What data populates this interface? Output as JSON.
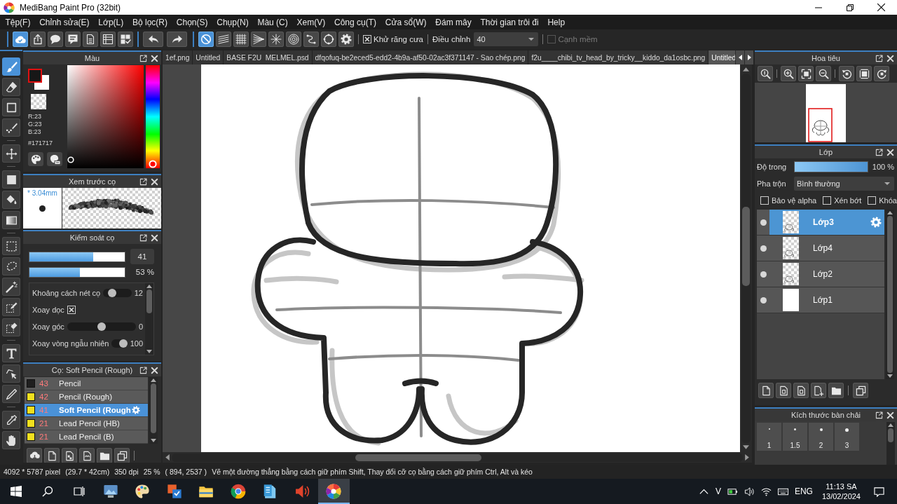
{
  "window": {
    "title": "MediBang Paint Pro (32bit)"
  },
  "menu": [
    "Tệp(F)",
    "Chỉnh sửa(E)",
    "Lớp(L)",
    "Bộ lọc(R)",
    "Chọn(S)",
    "Chụp(N)",
    "Màu (C)",
    "Xem(V)",
    "Công cụ(T)",
    "Cửa sổ(W)",
    "Đám mây",
    "Thời gian trôi đi",
    "Help"
  ],
  "toolbar": {
    "file_buttons": [
      {
        "kind": "cloud",
        "selected": true
      },
      {
        "kind": "share",
        "selected": false
      },
      {
        "kind": "speech",
        "selected": false
      },
      {
        "kind": "comment",
        "selected": false
      },
      {
        "kind": "page",
        "selected": false
      },
      {
        "kind": "table",
        "selected": false
      },
      {
        "kind": "checklist",
        "selected": false
      }
    ],
    "history_buttons": [
      {
        "kind": "undo"
      },
      {
        "kind": "redo"
      }
    ],
    "ruler_buttons": [
      {
        "kind": "off",
        "selected": true
      },
      {
        "kind": "parallel",
        "selected": false
      },
      {
        "kind": "grid",
        "selected": false
      },
      {
        "kind": "perspective",
        "selected": false
      },
      {
        "kind": "radial",
        "selected": false
      },
      {
        "kind": "concentric",
        "selected": false
      },
      {
        "kind": "curve",
        "selected": false
      },
      {
        "kind": "ellipse",
        "selected": false
      },
      {
        "kind": "gear",
        "selected": false
      }
    ],
    "antialias": {
      "label": "Khử răng cưa",
      "checked": true
    },
    "correction": {
      "label": "Điều chỉnh",
      "value": "40"
    },
    "soft_edge": {
      "label": "Cạnh mềm",
      "checked": false,
      "disabled": true
    }
  },
  "tool_groups": [
    [
      {
        "kind": "brush",
        "selected": true
      },
      {
        "kind": "eraser",
        "selected": false
      },
      {
        "kind": "shape",
        "selected": false
      },
      {
        "kind": "dotpen",
        "selected": false
      }
    ],
    [
      {
        "kind": "move",
        "selected": false
      }
    ],
    [
      {
        "kind": "fill",
        "selected": false
      },
      {
        "kind": "bucket",
        "selected": false
      },
      {
        "kind": "gradient",
        "selected": false
      }
    ],
    [
      {
        "kind": "select",
        "selected": false
      },
      {
        "kind": "lasso",
        "selected": false
      },
      {
        "kind": "wand",
        "selected": false
      },
      {
        "kind": "selpen",
        "selected": false
      },
      {
        "kind": "seleraser",
        "selected": false
      }
    ],
    [
      {
        "kind": "text",
        "selected": false
      },
      {
        "kind": "operation",
        "selected": false
      },
      {
        "kind": "divide",
        "selected": false
      }
    ],
    [
      {
        "kind": "eyedropper",
        "selected": false
      },
      {
        "kind": "hand",
        "selected": false
      }
    ]
  ],
  "color_panel": {
    "title": "Màu",
    "red": "R:23",
    "green": "G:23",
    "blue": "B:23",
    "hex": "#171717"
  },
  "brush_preview": {
    "title": "Xem trước cọ",
    "size": "* 3.04mm"
  },
  "brush_control": {
    "title": "Kiểm soát cọ",
    "size": {
      "level": 0.67,
      "value": "41"
    },
    "opacity": {
      "level": 0.53,
      "reading": "53 %"
    },
    "settings": [
      {
        "kind": "slider",
        "label": "Khoảng cách nét cọ",
        "level": 0.25,
        "value": "12"
      },
      {
        "kind": "checkbox",
        "label": "Xoay dọc",
        "checked": true
      },
      {
        "kind": "slider",
        "label": "Xoay góc",
        "level": 0.5,
        "value": "0"
      },
      {
        "kind": "slider",
        "label": "Xoay vòng ngẫu nhiên",
        "level": 1,
        "value": "100"
      }
    ]
  },
  "brush_list": {
    "title": "Cọ: Soft Pencil (Rough)",
    "items": [
      {
        "size": "43",
        "name": "Pencil",
        "color": "#1f1f1f",
        "selected": false
      },
      {
        "size": "42",
        "name": "Pencil (Rough)",
        "color": "#f0e01e",
        "selected": false
      },
      {
        "size": "41",
        "name": "Soft Pencil (Rough",
        "color": "#f0e01e",
        "selected": true
      },
      {
        "size": "21",
        "name": "Lead Pencil (HB)",
        "color": "#f0e01e",
        "selected": false
      },
      {
        "size": "21",
        "name": "Lead Pencil (B)",
        "color": "#f0e01e",
        "selected": false
      }
    ],
    "buttons": [
      {
        "kind": "download"
      },
      {
        "kind": "new_page"
      },
      {
        "kind": "page_checker"
      },
      {
        "kind": "script"
      },
      {
        "kind": "folder"
      },
      {
        "kind": "duplicate"
      }
    ]
  },
  "document_tabs": [
    {
      "label": "1ef.png",
      "selected": false
    },
    {
      "label": "Untitled",
      "selected": false
    },
    {
      "label": "BASE F2U  MELMEL.psd",
      "selected": false
    },
    {
      "label": "dfqofuq-be2eced5-edd2-4b9a-af50-02ac3f371147 - Sao chép.png",
      "selected": false
    },
    {
      "label": "f2u____chibi_tv_head_by_tricky__kiddo_da1osbc.png",
      "selected": false
    },
    {
      "label": "Untitled",
      "selected": true
    }
  ],
  "navigator": {
    "title": "Hoa tiêu",
    "button_groups": [
      [
        {
          "kind": "zoom_actual"
        }
      ],
      [
        {
          "kind": "zoom_in"
        },
        {
          "kind": "fit"
        },
        {
          "kind": "zoom_out"
        }
      ],
      [
        {
          "kind": "rotate_left"
        },
        {
          "kind": "frame"
        },
        {
          "kind": "rotate_right"
        }
      ]
    ]
  },
  "layer_panel": {
    "title": "Lớp",
    "opacity": {
      "label": "Độ trong",
      "level": 1,
      "reading": "100 %"
    },
    "blend": {
      "label": "Pha trộn",
      "value": "Bình thường"
    },
    "options": [
      {
        "label": "Bảo vệ alpha",
        "checked": false
      },
      {
        "label": "Xén bớt",
        "checked": false
      },
      {
        "label": "Khóa",
        "checked": false
      }
    ],
    "layers": [
      {
        "name": "Lớp3",
        "kind": "sketch",
        "visible": true,
        "selected": true
      },
      {
        "name": "Lớp4",
        "kind": "sketch",
        "visible": true,
        "selected": false
      },
      {
        "name": "Lớp2",
        "kind": "sketch",
        "visible": true,
        "selected": false
      },
      {
        "name": "Lớp1",
        "kind": "fill",
        "visible": true,
        "selected": false
      }
    ],
    "button_groups": [
      [
        {
          "kind": "new_page"
        },
        {
          "kind": "page_box"
        },
        {
          "kind": "page_box"
        },
        {
          "kind": "page_plus"
        },
        {
          "kind": "folder"
        }
      ],
      [
        {
          "kind": "duplicate"
        }
      ]
    ]
  },
  "brush_size_panel": {
    "title": "Kích thước bàn chải",
    "sizes": [
      "1",
      "1.5",
      "2",
      "3"
    ]
  },
  "status_bar": {
    "size": "4092 * 5787 pixel",
    "physical": "(29.7 * 42cm)",
    "resolution": "350 dpi",
    "zoom": "25 %",
    "cursor": "( 894, 2537 )",
    "hint": "Vẽ một đường thẳng bằng cách giữ phím Shift, Thay đổi cỡ cọ bằng cách giữ phím Ctrl, Alt và kéo"
  },
  "taskbar": {
    "apps": [
      {
        "kind": "picture",
        "selected": false
      },
      {
        "kind": "palette",
        "selected": false
      },
      {
        "kind": "office",
        "selected": false
      },
      {
        "kind": "explorer",
        "selected": false
      },
      {
        "kind": "browser",
        "selected": false
      },
      {
        "kind": "notepad",
        "selected": false
      },
      {
        "kind": "speaker",
        "selected": false
      },
      {
        "kind": "medibang",
        "selected": true
      }
    ],
    "input_mode": "V",
    "language": "ENG",
    "time": "11:13 SA",
    "date": "13/02/2024"
  }
}
